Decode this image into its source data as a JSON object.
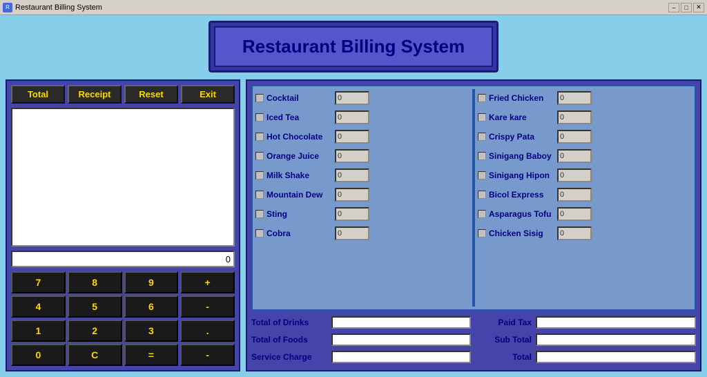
{
  "titlebar": {
    "icon": "R",
    "title": "Restaurant Billing System",
    "minimize": "–",
    "maximize": "□",
    "close": "✕"
  },
  "header": {
    "title": "Restaurant Billing System"
  },
  "buttons": {
    "total": "Total",
    "receipt": "Receipt",
    "reset": "Reset",
    "exit": "Exit"
  },
  "numpad": {
    "keys": [
      "7",
      "4",
      "1",
      "0",
      "8",
      "C",
      "5",
      "2",
      "9",
      "-",
      "6",
      "3",
      "+",
      ".",
      "-",
      "="
    ],
    "display": "0"
  },
  "drinks": [
    {
      "label": "Cocktail",
      "value": "0"
    },
    {
      "label": "Iced Tea",
      "value": "0"
    },
    {
      "label": "Hot Chocolate",
      "value": "0"
    },
    {
      "label": "Orange Juice",
      "value": "0"
    },
    {
      "label": "Milk Shake",
      "value": "0"
    },
    {
      "label": "Mountain Dew",
      "value": "0"
    },
    {
      "label": "Sting",
      "value": "0"
    },
    {
      "label": "Cobra",
      "value": "0"
    }
  ],
  "foods": [
    {
      "label": "Fried Chicken",
      "value": "0"
    },
    {
      "label": "Kare kare",
      "value": "0"
    },
    {
      "label": "Crispy Pata",
      "value": "0"
    },
    {
      "label": "Sinigang Baboy",
      "value": "0"
    },
    {
      "label": "Sinigang Hipon",
      "value": "0"
    },
    {
      "label": "Bicol Express",
      "value": "0"
    },
    {
      "label": "Asparagus Tofu",
      "value": "0"
    },
    {
      "label": "Chicken Sisig",
      "value": "0"
    }
  ],
  "summary": {
    "total_drinks_label": "Total of Drinks",
    "total_foods_label": "Total of Foods",
    "service_charge_label": "Service Charge",
    "paid_tax_label": "Paid Tax",
    "sub_total_label": "Sub Total",
    "total_label": "Total",
    "total_drinks_value": "",
    "total_foods_value": "",
    "service_charge_value": "",
    "paid_tax_value": "",
    "sub_total_value": "",
    "total_value": ""
  }
}
